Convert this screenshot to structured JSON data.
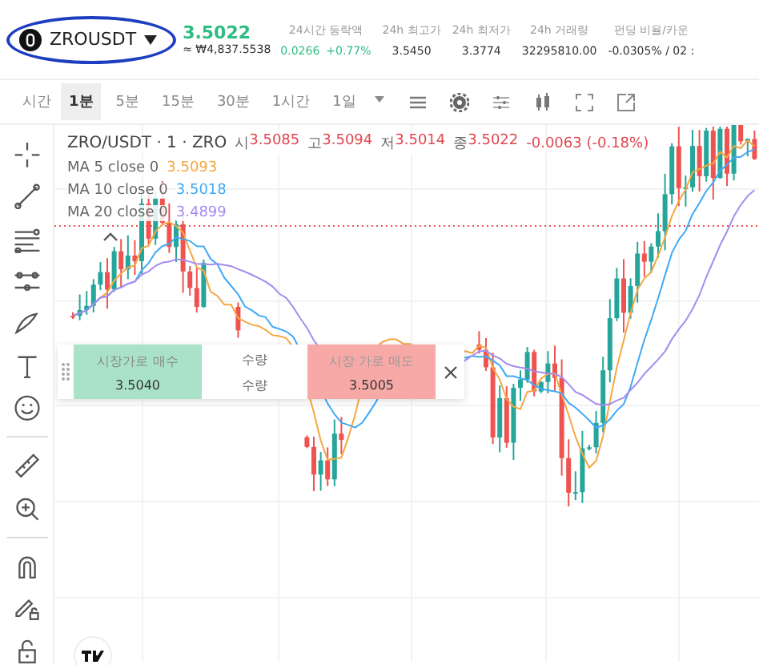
{
  "symbol": {
    "name": "ZROUSDT",
    "price": "3.5022",
    "fiat_price": "≈ ₩4,837.5538",
    "circled": true
  },
  "stats": [
    {
      "kind": "change",
      "label": "24시간 등락액",
      "values": [
        "0.0266",
        "+0.77%"
      ]
    },
    {
      "kind": "plain",
      "label": "24h 최고가",
      "values": [
        "3.5450"
      ]
    },
    {
      "kind": "plain",
      "label": "24h 최저가",
      "values": [
        "3.3774"
      ]
    },
    {
      "kind": "plain",
      "label": "24h 거래량",
      "values": [
        "32295810.00"
      ]
    },
    {
      "kind": "plain",
      "label": "펀딩 비율/카운",
      "values": [
        "-0.0305% / 02 :"
      ]
    }
  ],
  "interval_label": "시간",
  "intervals": [
    {
      "label": "1분",
      "selected": true
    },
    {
      "label": "5분",
      "selected": false
    },
    {
      "label": "15분",
      "selected": false
    },
    {
      "label": "30분",
      "selected": false
    },
    {
      "label": "1시간",
      "selected": false
    },
    {
      "label": "1일",
      "selected": false
    }
  ],
  "legend": {
    "title": "ZRO/USDT · 1 · ZRO",
    "ohlc": [
      {
        "label": "시",
        "value": "3.5085"
      },
      {
        "label": "고",
        "value": "3.5094"
      },
      {
        "label": "저",
        "value": "3.5014"
      },
      {
        "label": "종",
        "value": "3.5022"
      }
    ],
    "change": "-0.0063 (-0.18%)"
  },
  "indicators": [
    {
      "label": "MA 5 close 0",
      "value": "3.5093",
      "color": "#f5a742"
    },
    {
      "label": "MA 10 close 0",
      "value": "3.5018",
      "color": "#3fa9f5"
    },
    {
      "label": "MA 20 close 0",
      "value": "3.4899",
      "color": "#a58cf0"
    }
  ],
  "order_panel": {
    "buy": {
      "label": "시장가로 매수",
      "price": "3.5040"
    },
    "quantity_labels": [
      "수량",
      "수량"
    ],
    "sell": {
      "label": "시장 가로 매도",
      "price": "3.5005"
    }
  }
}
